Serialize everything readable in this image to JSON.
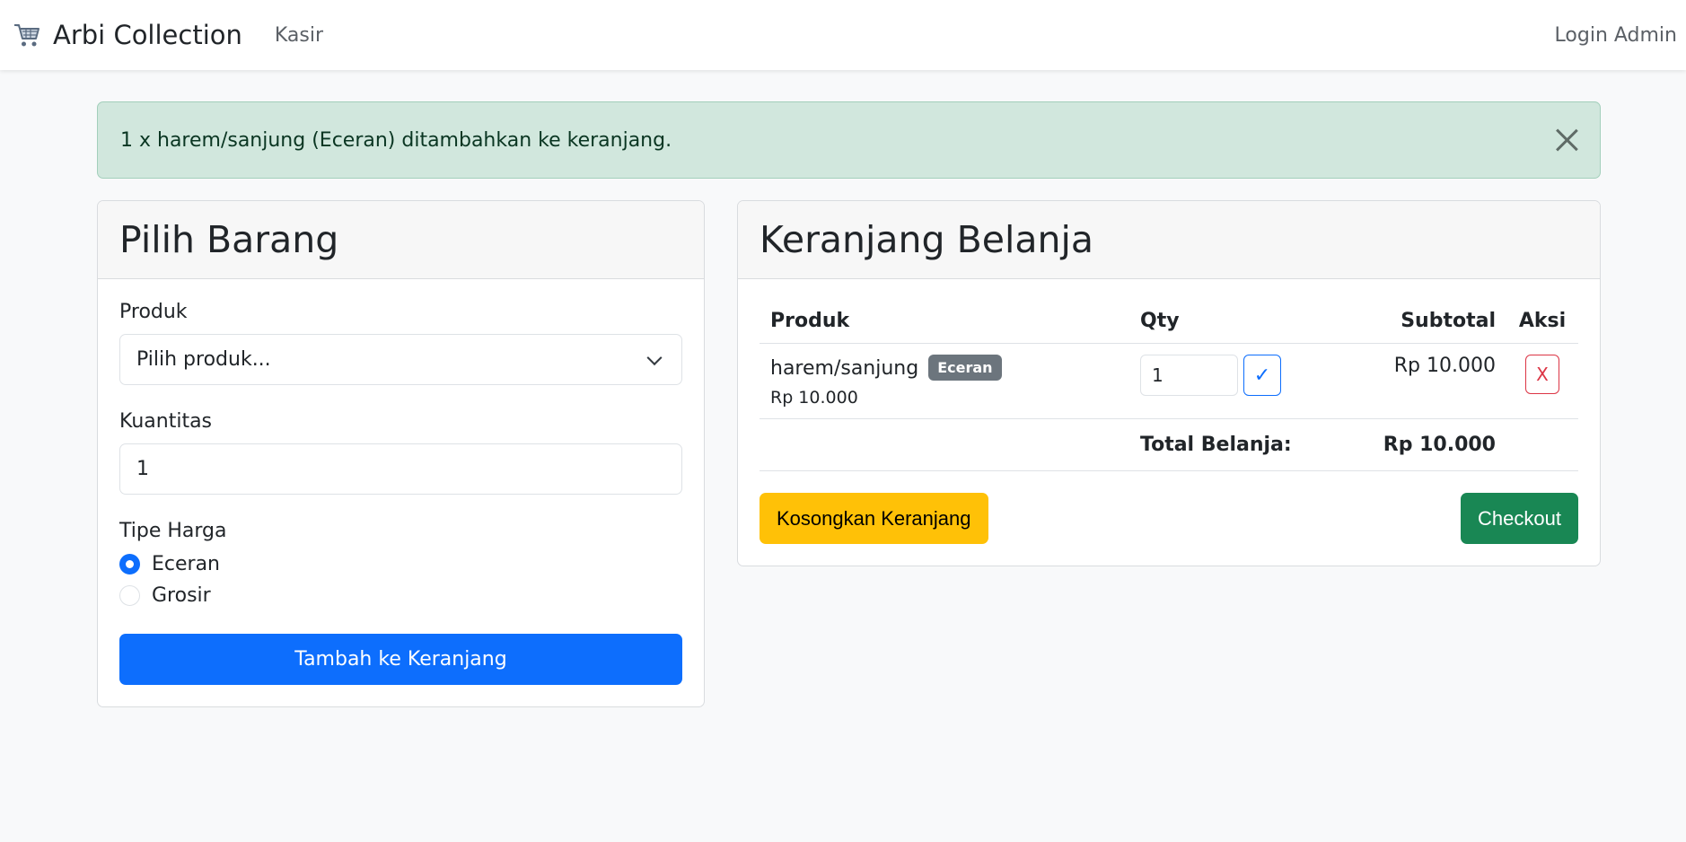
{
  "navbar": {
    "brand": "Arbi Collection",
    "brand_icon": "shopping-cart-icon",
    "link_kasir": "Kasir",
    "login": "Login Admin"
  },
  "alert": {
    "message": "1 x harem/sanjung (Eceran) ditambahkan ke keranjang."
  },
  "pilih_barang": {
    "title": "Pilih Barang",
    "produk_label": "Produk",
    "produk_selected": "Pilih produk...",
    "kuantitas_label": "Kuantitas",
    "kuantitas_value": "1",
    "tipe_harga_label": "Tipe Harga",
    "options": [
      {
        "label": "Eceran",
        "checked": true
      },
      {
        "label": "Grosir",
        "checked": false
      }
    ],
    "submit": "Tambah ke Keranjang"
  },
  "keranjang": {
    "title": "Keranjang Belanja",
    "columns": [
      "Produk",
      "Qty",
      "Subtotal",
      "Aksi"
    ],
    "items": [
      {
        "name": "harem/sanjung",
        "badge": "Eceran",
        "price": "Rp 10.000",
        "qty": "1",
        "update_symbol": "✓",
        "subtotal": "Rp 10.000",
        "remove_symbol": "X"
      }
    ],
    "total_label": "Total Belanja:",
    "total_value": "Rp 10.000",
    "clear_button": "Kosongkan Keranjang",
    "checkout_button": "Checkout"
  },
  "colors": {
    "primary": "#0d6efd",
    "success": "#198754",
    "warning": "#ffc107",
    "danger": "#dc3545",
    "alert_bg": "#d1e7dd"
  }
}
